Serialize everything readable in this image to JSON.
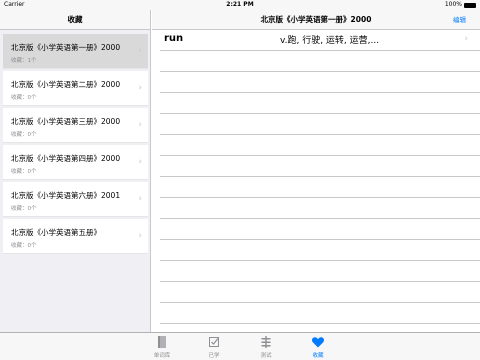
{
  "status": {
    "carrier": "Carrier",
    "time": "2:21 PM",
    "battery": "100%"
  },
  "master": {
    "title": "收藏",
    "items": [
      {
        "title": "北京版《小学英语第一册》2000",
        "count": "收藏：1个"
      },
      {
        "title": "北京版《小学英语第二册》2000",
        "count": "收藏：0个"
      },
      {
        "title": "北京版《小学英语第三册》2000",
        "count": "收藏：0个"
      },
      {
        "title": "北京版《小学英语第四册》2000",
        "count": "收藏：0个"
      },
      {
        "title": "北京版《小学英语第六册》2001",
        "count": "收藏：0个"
      },
      {
        "title": "北京版《小学英语第五册》",
        "count": "收藏：0个"
      }
    ]
  },
  "detail": {
    "title": "北京版《小学英语第一册》2000",
    "edit": "编辑",
    "rows": [
      {
        "word": "run",
        "definition": "v.跑, 行驶, 运转, 运营,..."
      }
    ]
  },
  "tabs": [
    {
      "label": "单词库",
      "icon": "book-icon"
    },
    {
      "label": "已学",
      "icon": "checklist-icon"
    },
    {
      "label": "测试",
      "icon": "test-icon"
    },
    {
      "label": "收藏",
      "icon": "heart-icon"
    }
  ],
  "colors": {
    "accent": "#007aff",
    "selected_cell": "#d9d9d9",
    "inactive_tab": "#8e8e93"
  }
}
